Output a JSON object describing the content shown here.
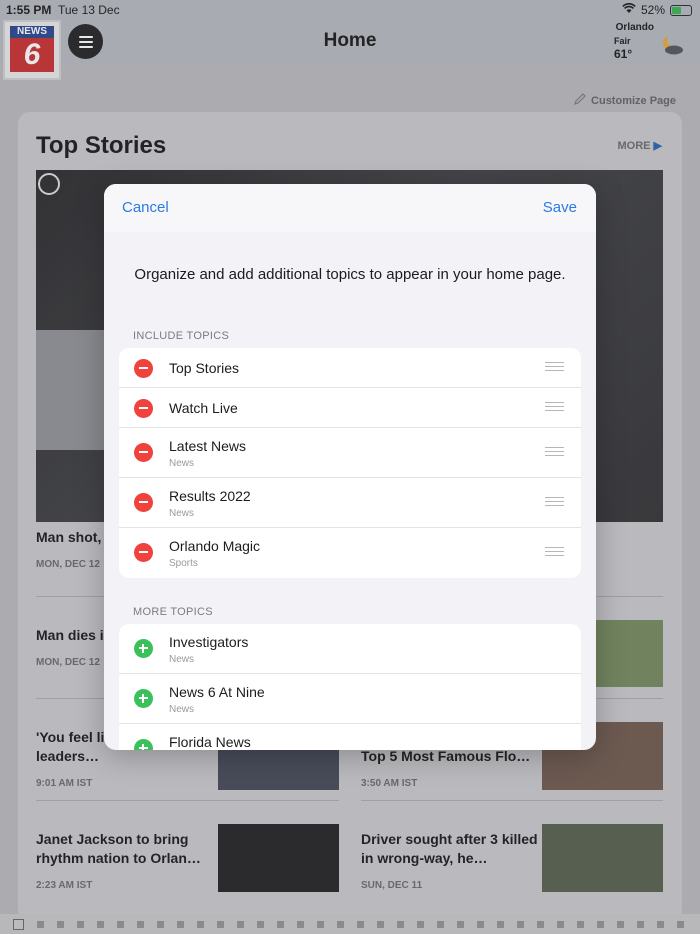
{
  "status_bar": {
    "time": "1:55 PM",
    "date": "Tue 13 Dec",
    "battery": "52%"
  },
  "header": {
    "title": "Home",
    "logo_top": "NEWS",
    "logo_number": "6"
  },
  "weather": {
    "city": "Orlando",
    "condition": "Fair",
    "temperature": "61°"
  },
  "page": {
    "customize_label": "Customize Page",
    "section_title": "Top Stories",
    "more_label": "MORE",
    "stories": [
      {
        "title": "Man shot, deputies s",
        "meta": "MON, DEC 12"
      },
      {
        "title": "Man dies i delivering",
        "meta": "MON, DEC 12"
      },
      {
        "title": "'You feel li Orange County leaders…",
        "meta": "9:01 AM IST"
      },
      {
        "title": "Top 5 Most Famous Flo…",
        "meta": "3:50 AM IST"
      },
      {
        "title": "Janet Jackson to bring rhythm nation to Orlan…",
        "meta": "2:23 AM IST"
      },
      {
        "title": "Driver sought after 3 killed in wrong-way, he…",
        "meta": "SUN, DEC 11"
      }
    ]
  },
  "modal": {
    "cancel_label": "Cancel",
    "save_label": "Save",
    "description": "Organize and add additional topics to appear in your home page.",
    "include_label": "INCLUDE TOPICS",
    "include_topics": [
      {
        "name": "Top Stories",
        "category": ""
      },
      {
        "name": "Watch Live",
        "category": ""
      },
      {
        "name": "Latest News",
        "category": "News"
      },
      {
        "name": "Results 2022",
        "category": "News"
      },
      {
        "name": "Orlando Magic",
        "category": "Sports"
      }
    ],
    "more_label": "MORE TOPICS",
    "more_topics": [
      {
        "name": "Investigators",
        "category": "News"
      },
      {
        "name": "News 6 At Nine",
        "category": "News"
      },
      {
        "name": "Florida News",
        "category": ""
      }
    ]
  },
  "colors": {
    "accent": "#2a7ae4",
    "remove": "#f0413c",
    "add": "#3bc15c"
  }
}
